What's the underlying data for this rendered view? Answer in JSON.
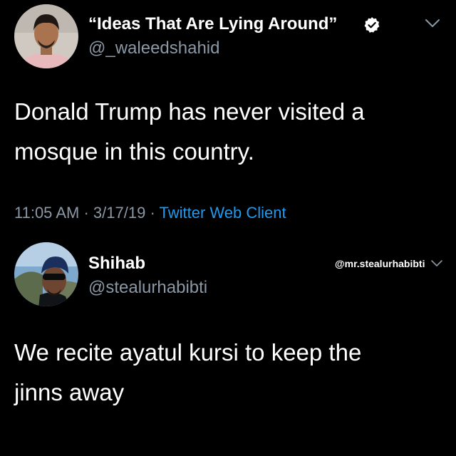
{
  "tweet": {
    "author": {
      "display_name": "“Ideas That Are Lying Around”",
      "handle": "@_waleedshahid",
      "verified": true
    },
    "text_lines": [
      "Donald Trump has never visited a",
      "mosque in this country."
    ],
    "time": "11:05 AM",
    "date": "3/17/19",
    "separator": "·",
    "client": "Twitter Web Client"
  },
  "reply": {
    "author": {
      "display_name": "Shihab",
      "handle": "@stealurhabibti"
    },
    "text_lines": [
      "We recite ayatul kursi to keep the",
      "jinns away"
    ]
  },
  "watermark": "@mr.stealurhabibti",
  "icons": {
    "verified": "verified-badge-icon",
    "menu": "chevron-down-icon"
  },
  "colors": {
    "background": "#000000",
    "text": "#ffffff",
    "secondary_text": "#8b98a5",
    "link": "#1d9bf0"
  }
}
